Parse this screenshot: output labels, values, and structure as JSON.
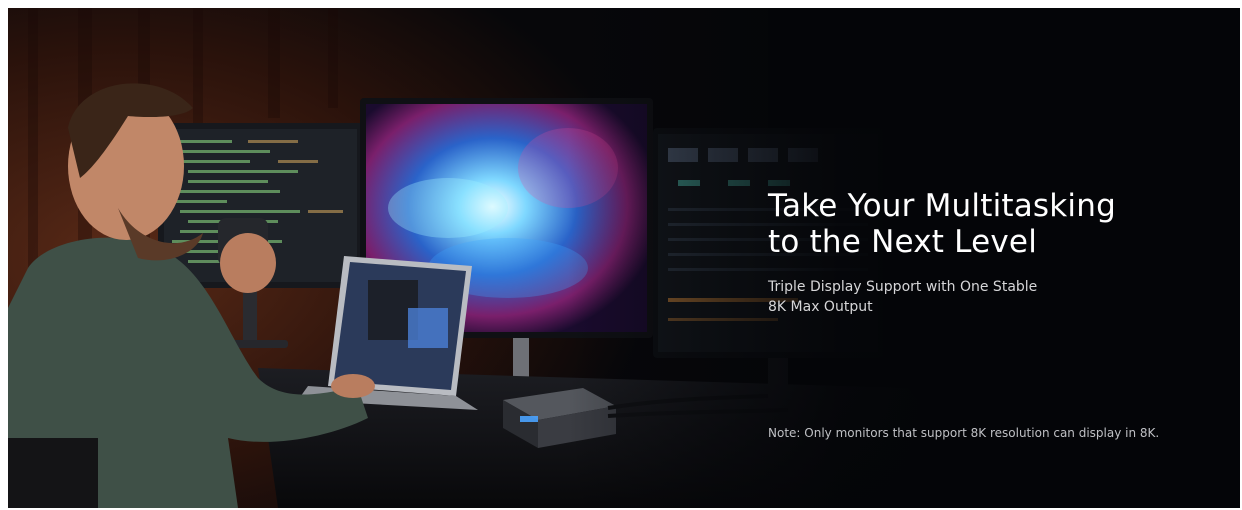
{
  "banner": {
    "headline_line1": "Take Your Multitasking",
    "headline_line2": "to the Next Level",
    "subline_line1": "Triple Display Support with One Stable",
    "subline_line2": "8K Max Output",
    "note": "Note: Only monitors that support 8K resolution can display in 8K."
  },
  "colors": {
    "background": "#040508",
    "headline": "#ffffff",
    "subline": "#d6d6d8",
    "note": "#bfc0c4"
  }
}
